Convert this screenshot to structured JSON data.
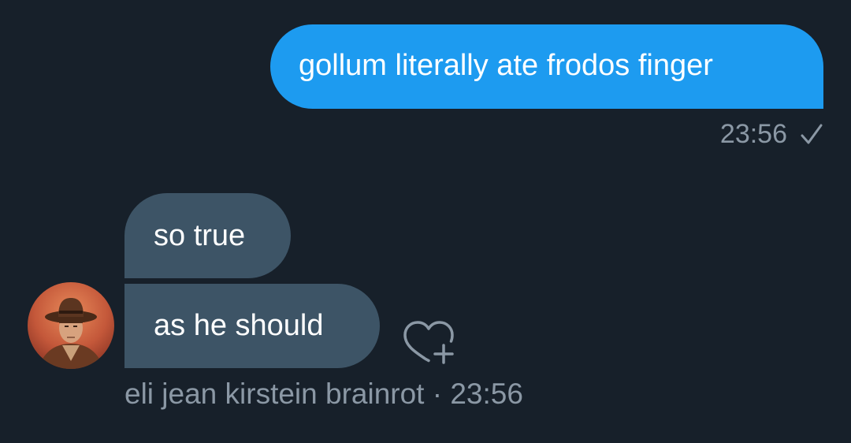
{
  "colors": {
    "background": "#17202a",
    "sent_bubble": "#1d9bf0",
    "received_bubble": "#3d5466",
    "meta_text": "#8b98a5"
  },
  "sent_message": {
    "text": "gollum literally ate frodos finger",
    "time": "23:56",
    "status_icon": "checkmark-icon"
  },
  "received_messages": [
    {
      "text": "so true"
    },
    {
      "text": "as he should"
    }
  ],
  "received_meta": {
    "sender": "eli jean kirstein brainrot",
    "separator": "·",
    "time": "23:56"
  },
  "icons": {
    "avatar": "profile-avatar",
    "react": "heart-plus-icon"
  }
}
